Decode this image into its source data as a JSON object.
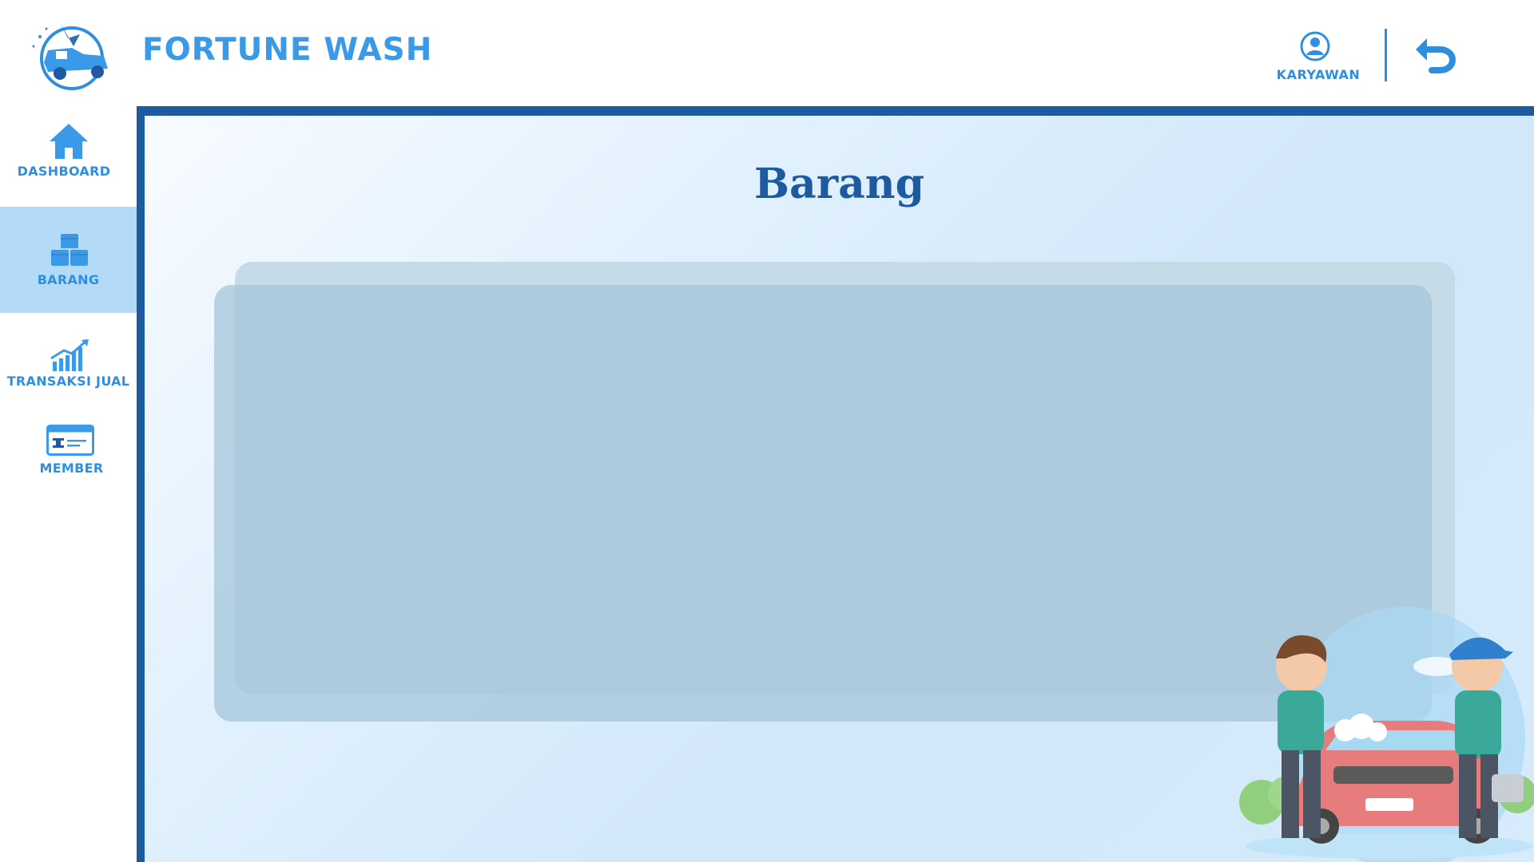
{
  "app": {
    "brand": "FORTUNE WASH",
    "logo_icon": "car-wash-logo-icon"
  },
  "header": {
    "user_label": "KARYAWAN",
    "user_icon": "user-circle-icon",
    "back_icon": "back-arrow-icon"
  },
  "sidebar": {
    "items": [
      {
        "label": "DASHBOARD",
        "icon": "home-icon",
        "active": false
      },
      {
        "label": "BARANG",
        "icon": "boxes-icon",
        "active": true
      },
      {
        "label": "TRANSAKSI JUAL",
        "icon": "growth-chart-icon",
        "active": false
      },
      {
        "label": "MEMBER",
        "icon": "member-card-icon",
        "active": false
      }
    ]
  },
  "main": {
    "title": "Barang"
  },
  "colors": {
    "accent": "#3b9ae8",
    "dark_blue": "#1d5aa0",
    "active_bg": "#b3daf7",
    "card": "#a4c6da"
  }
}
